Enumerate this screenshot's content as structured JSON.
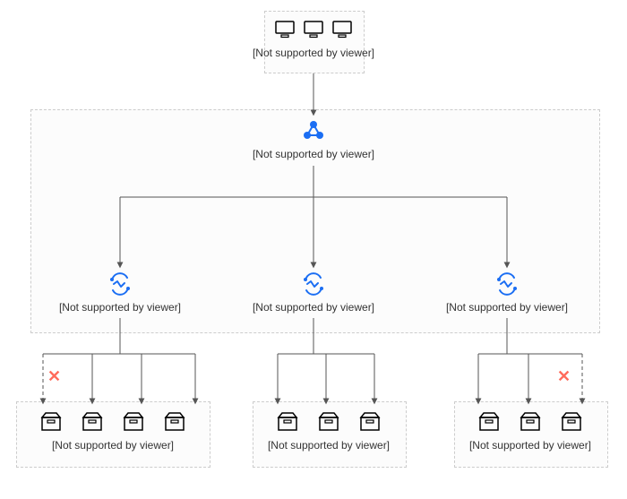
{
  "top": {
    "caption": "[Not supported by viewer]"
  },
  "balancer": {
    "caption": "[Not supported by viewer]"
  },
  "ecs": {
    "left": {
      "caption": "[Not supported by viewer]"
    },
    "center": {
      "caption": "[Not supported by viewer]"
    },
    "right": {
      "caption": "[Not supported by viewer]"
    }
  },
  "storage": {
    "left": {
      "caption": "[Not supported by viewer]"
    },
    "center": {
      "caption": "[Not supported by viewer]"
    },
    "right": {
      "caption": "[Not supported by viewer]"
    }
  }
}
